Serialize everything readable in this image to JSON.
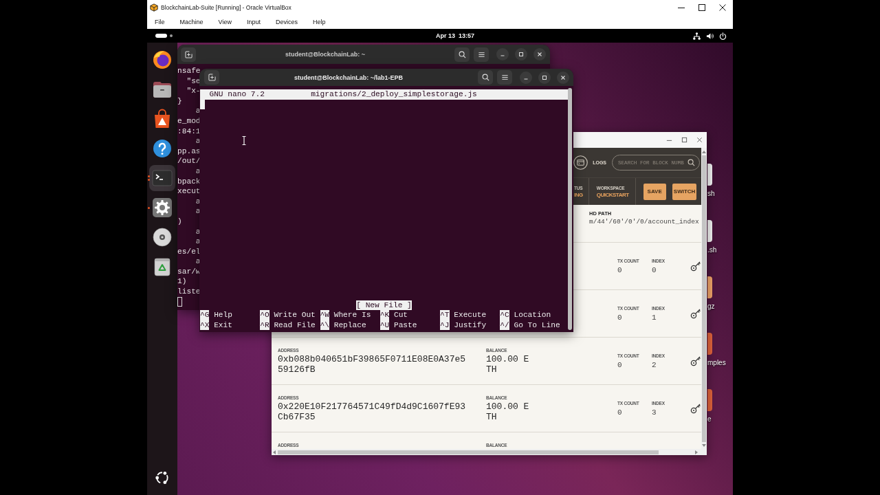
{
  "vbox": {
    "title": "BlockchainLab-Suite [Running] - Oracle VirtualBox",
    "menu": [
      "File",
      "Machine",
      "View",
      "Input",
      "Devices",
      "Help"
    ]
  },
  "topbar": {
    "clock": "Apr 13  13:57"
  },
  "dock": {
    "items": [
      {
        "kind": "browser",
        "selected": false,
        "running": false,
        "multiple": false
      },
      {
        "kind": "files",
        "selected": false,
        "running": false,
        "multiple": false
      },
      {
        "kind": "store",
        "selected": false,
        "running": false,
        "multiple": false
      },
      {
        "kind": "help",
        "selected": false,
        "running": false,
        "multiple": false
      },
      {
        "kind": "terminal",
        "selected": true,
        "running": true,
        "multiple": true
      },
      {
        "kind": "settings",
        "selected": false,
        "running": true,
        "multiple": false
      },
      {
        "kind": "disc",
        "selected": false,
        "running": false,
        "multiple": false
      },
      {
        "kind": "trash",
        "selected": false,
        "running": false,
        "multiple": false
      }
    ]
  },
  "back_terminal": {
    "title": "student@BlockchainLab: ~",
    "focused": false,
    "lines": [
      "nsafe",
      "  \"se",
      "  \"x-",
      "}",
      "    a",
      "e_mod",
      ":84:1",
      "    a",
      "pp.as",
      "/out/",
      "    a",
      "bpack",
      "xecut",
      "    a",
      "    a",
      ")",
      "    a",
      "    a",
      "es/el",
      "    a",
      "sar/w",
      "1)",
      "liste"
    ]
  },
  "nano_terminal": {
    "title": "student@BlockchainLab: ~/lab1-EPB",
    "focused": true,
    "nano": {
      "version": "GNU nano 7.2",
      "file": "migrations/2_deploy_simplestorage.js",
      "status": "[ New File ]",
      "shortcuts": [
        {
          "key": "^G",
          "label": "Help"
        },
        {
          "key": "^O",
          "label": "Write Out"
        },
        {
          "key": "^W",
          "label": "Where Is"
        },
        {
          "key": "^K",
          "label": "Cut"
        },
        {
          "key": "^T",
          "label": "Execute"
        },
        {
          "key": "^C",
          "label": "Location"
        },
        {
          "key": "^X",
          "label": "Exit"
        },
        {
          "key": "^R",
          "label": "Read File"
        },
        {
          "key": "^\\",
          "label": "Replace"
        },
        {
          "key": "^U",
          "label": "Paste"
        },
        {
          "key": "^J",
          "label": "Justify"
        },
        {
          "key": "^/",
          "label": "Go To Line"
        }
      ]
    }
  },
  "ganache": {
    "logs": "LOGS",
    "search": {
      "placeholder": "SEARCH FOR BLOCK NUMB"
    },
    "status": {
      "label": "TUS",
      "value": "ING"
    },
    "workspace": {
      "label": "WORKSPACE",
      "value": "QUICKSTART"
    },
    "buttons": [
      "SAVE",
      "SWITCH"
    ],
    "hd_path": {
      "label": "HD PATH",
      "value": "m/44'/60'/0'/0/account_index"
    },
    "accounts": [
      {
        "tx_count_label": "TX COUNT",
        "tx_count": "0",
        "index_label": "INDEX",
        "index": "0"
      },
      {
        "tx_count_label": "TX COUNT",
        "tx_count": "0",
        "index_label": "INDEX",
        "index": "1"
      },
      {
        "address_label": "ADDRESS",
        "address": "0xb088b040651bF39865F0711E08E0A37e559126fB",
        "balance_label": "BALANCE",
        "balance": "100.00 ETH",
        "tx_count_label": "TX COUNT",
        "tx_count": "0",
        "index_label": "INDEX",
        "index": "2"
      },
      {
        "address_label": "ADDRESS",
        "address": "0x220E10F217764571C49fD4d9C1607fE93Cb67F35",
        "balance_label": "BALANCE",
        "balance": "100.00 ETH",
        "tx_count_label": "TX COUNT",
        "tx_count": "0",
        "index_label": "INDEX",
        "index": "3"
      },
      {
        "address_label": "ADDRESS",
        "balance_label": "BALANCE"
      }
    ]
  },
  "desktop_icons": [
    {
      "kind": "file",
      "label": "sh"
    },
    {
      "kind": "file",
      "label": ".sh"
    },
    {
      "kind": "archive",
      "label": "gz"
    },
    {
      "kind": "folder",
      "label": "mples"
    },
    {
      "kind": "folder",
      "label": "e"
    }
  ]
}
